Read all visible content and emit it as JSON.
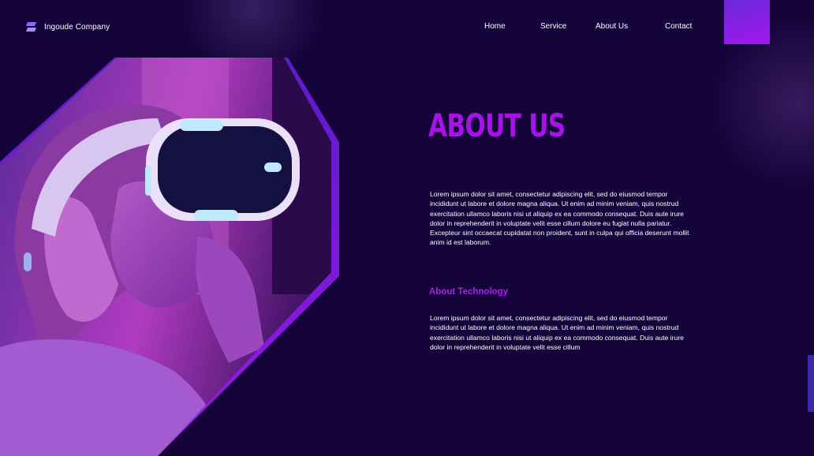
{
  "brand": {
    "name": "Ingoude Company",
    "icon": "stacked-tiles-logo-icon"
  },
  "nav": {
    "items": [
      "Home",
      "Service",
      "About Us",
      "Contact"
    ]
  },
  "hero": {
    "image": "woman-wearing-vr-headset",
    "frame_color": "#8e1ee6"
  },
  "about": {
    "title": "ABOUT US",
    "paragraph": "Lorem ipsum dolor sit amet, consectetur adipiscing elit, sed do eiusmod tempor incididunt ut labore et dolore magna aliqua. Ut enim ad minim veniam, quis nostrud exercitation ullamco laboris nisi ut aliquip ex ea commodo consequat. Duis aute irure dolor in reprehenderit in voluptate velit esse cillum dolore eu fugiat nulla pariatur. Excepteur sint occaecat cupidatat non proident, sunt in culpa qui officia deserunt mollit anim id est laborum.",
    "subtitle": "About Technology",
    "sub_paragraph": "Lorem ipsum dolor sit amet, consectetur adipiscing elit, sed do eiusmod tempor incididunt ut labore et dolore magna aliqua. Ut enim ad minim veniam, quis nostrud exercitation ullamco laboris nisi ut aliquip ex ea commodo consequat. Duis aute irure dolor in reprehenderit in voluptate velit esse cillum"
  },
  "colors": {
    "background": "#14043a",
    "accent": "#a613e6",
    "accent_light": "#b01cf0"
  }
}
